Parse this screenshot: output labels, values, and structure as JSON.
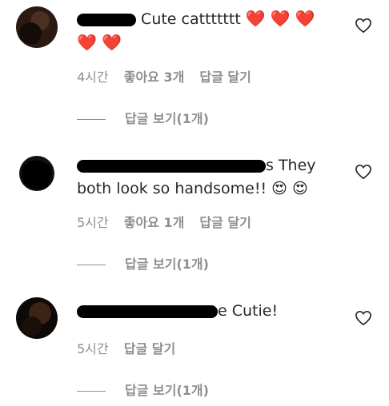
{
  "comments": [
    {
      "text": "Cute cattttttt",
      "hearts": [
        "❤️",
        "❤️",
        "❤️",
        "❤️",
        "❤️"
      ],
      "time": "4시간",
      "likes": "좋아요 3개",
      "reply": "답글 달기",
      "view_replies": "답글 보기(1개)"
    },
    {
      "line1_tail": "s They",
      "line2": "both look so handsome!!",
      "emojis": "😍 😍",
      "time": "5시간",
      "likes": "좋아요 1개",
      "reply": "답글 달기",
      "view_replies": "답글 보기(1개)"
    },
    {
      "text_tail": "e Cutie!",
      "time": "5시간",
      "reply": "답글 달기",
      "view_replies": "답글 보기(1개)"
    }
  ],
  "icons": {
    "like": "heart-outline-icon",
    "avatar": "avatar"
  },
  "colors": {
    "heart": "#e0152a",
    "meta": "#8e8e8e",
    "text": "#262626"
  }
}
